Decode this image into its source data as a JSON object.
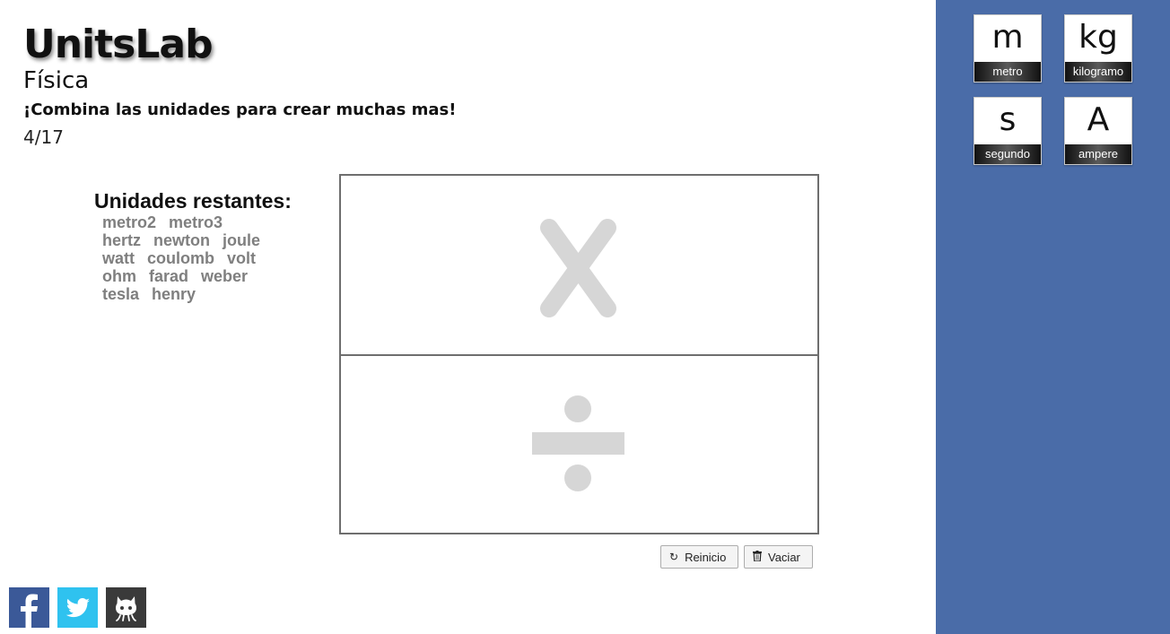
{
  "header": {
    "title": "UnitsLab",
    "subtitle": "Física",
    "tagline": "¡Combina las unidades para crear muchas mas!",
    "progress": "4/17"
  },
  "remaining": {
    "heading": "Unidades restantes:",
    "units": [
      "metro2",
      "metro3",
      "hertz",
      "newton",
      "joule",
      "watt",
      "coulomb",
      "volt",
      "ohm",
      "farad",
      "weber",
      "tesla",
      "henry"
    ]
  },
  "board": {
    "top_icon": "multiply-icon",
    "bottom_icon": "divide-icon",
    "icon_color": "#d6d6d6"
  },
  "buttons": {
    "reset_label": "Reinicio",
    "reset_icon": "refresh-icon",
    "empty_label": "Vaciar",
    "empty_icon": "trash-icon"
  },
  "social": [
    "facebook-icon",
    "twitter-icon",
    "github-icon"
  ],
  "sidebar": {
    "color": "#4a6ca8",
    "tiles": [
      {
        "symbol": "m",
        "name": "metro"
      },
      {
        "symbol": "kg",
        "name": "kilogramo"
      },
      {
        "symbol": "s",
        "name": "segundo"
      },
      {
        "symbol": "A",
        "name": "ampere"
      }
    ]
  }
}
